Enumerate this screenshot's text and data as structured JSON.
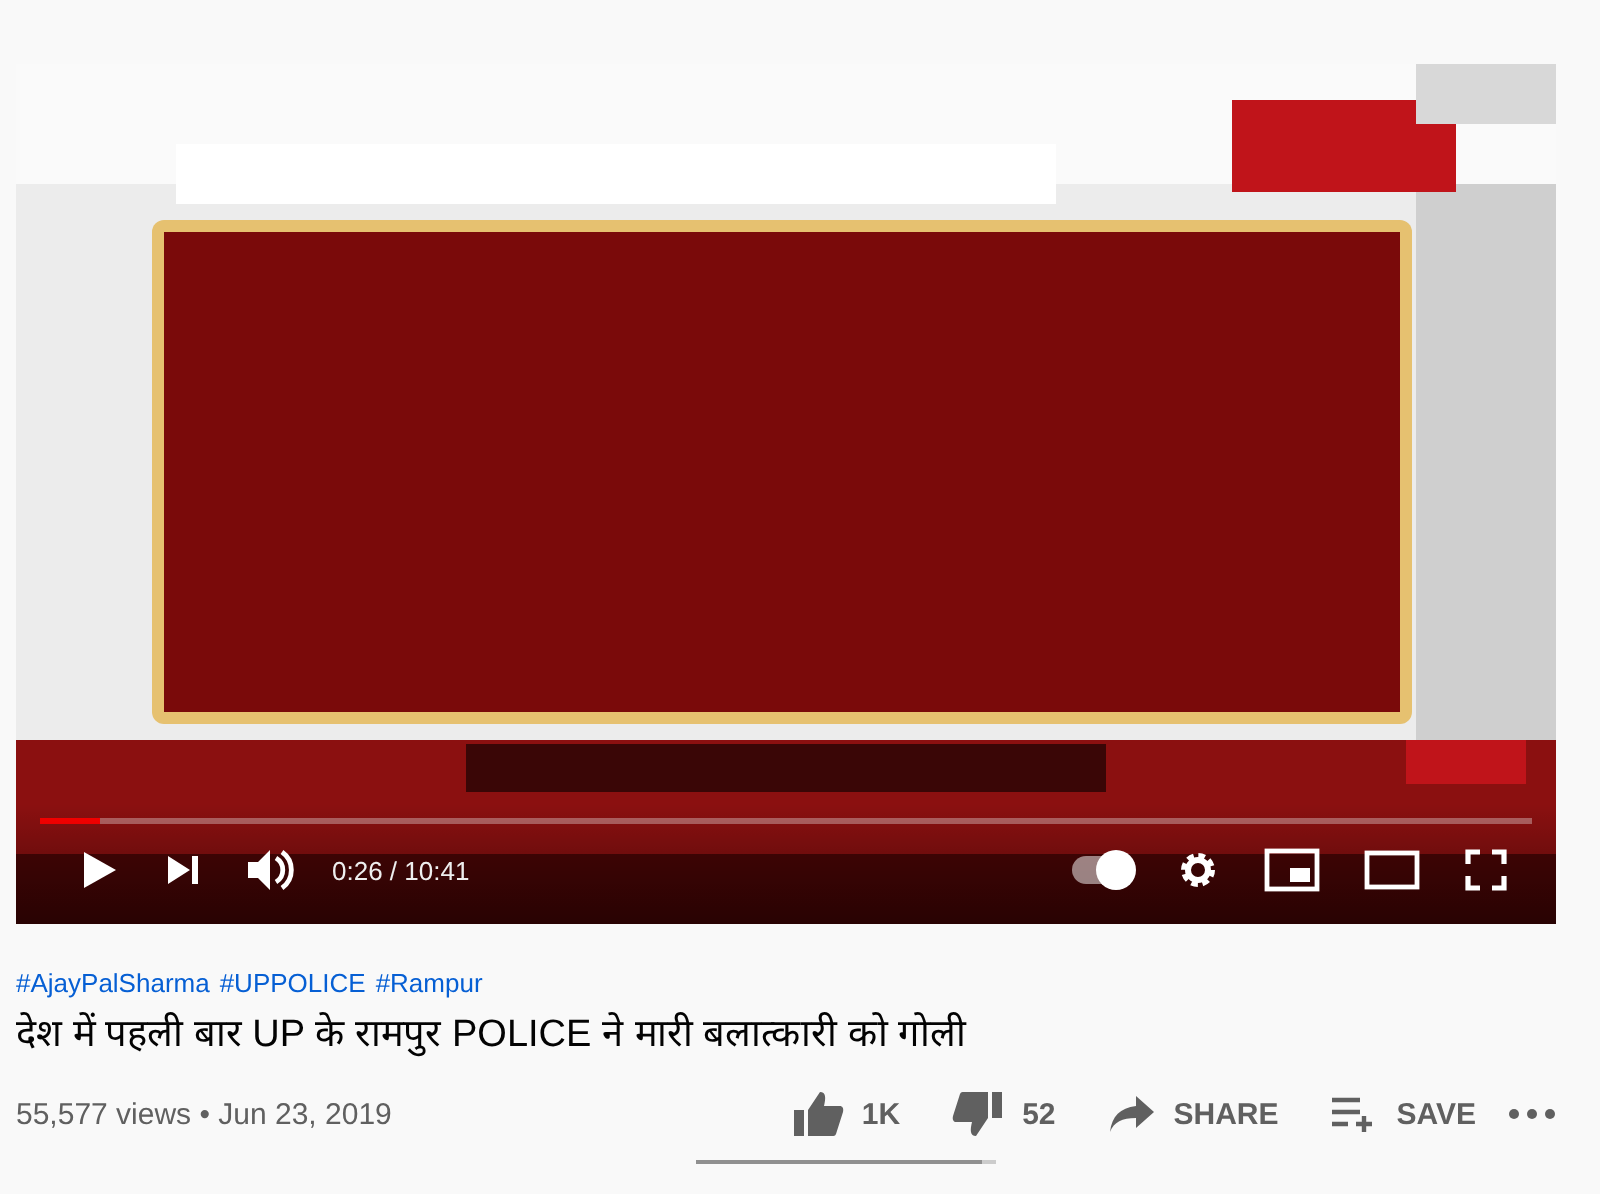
{
  "player": {
    "progress": {
      "level": 0.04
    },
    "time": "0:26 / 10:41",
    "autoplay": {
      "on": true
    }
  },
  "hashtags": [
    "#AjayPalSharma",
    "#UPPOLICE",
    "#Rampur"
  ],
  "title": "देश में पहली बार UP के रामपुर POLICE ने मारी बलात्कारी को गोली",
  "meta": {
    "views": "55,577 views",
    "separator": "•",
    "date": "Jun 23, 2019"
  },
  "actions": [
    {
      "kind": "like",
      "label": "1K"
    },
    {
      "kind": "dislike",
      "label": "52"
    },
    {
      "kind": "share",
      "label": "SHARE"
    },
    {
      "kind": "save",
      "label": "SAVE"
    },
    {
      "kind": "more"
    }
  ],
  "sentiment": {
    "level": 0.95
  }
}
